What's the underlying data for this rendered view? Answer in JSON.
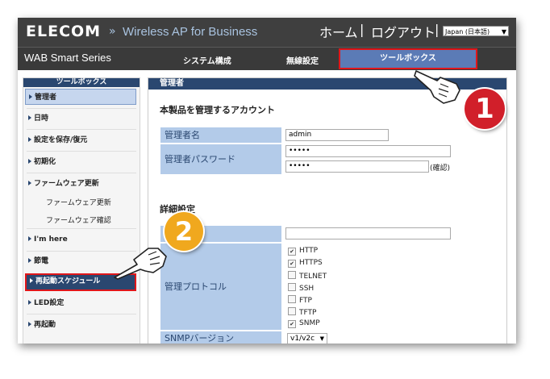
{
  "header": {
    "logo": "ELECOM",
    "separator": "»",
    "product": "Wireless AP for Business",
    "home": "ホーム",
    "divider": "|",
    "logout": "ログアウト",
    "language": "Japan (日本語)"
  },
  "nav": {
    "series": "WAB Smart Series",
    "items": [
      "システム構成",
      "無線設定",
      "ツールボックス"
    ]
  },
  "sidebar": {
    "title": "ツールボックス",
    "items": [
      "管理者",
      "日時",
      "設定を保存/復元",
      "初期化",
      "ファームウェア更新",
      "I'm here",
      "節電",
      "再起動スケジュール",
      "LED設定",
      "再起動"
    ],
    "subitems": [
      "ファームウェア更新",
      "ファームウェア確認"
    ]
  },
  "content": {
    "header": "管理者",
    "account_title": "本製品を管理するアカウント",
    "admin_name_label": "管理者名",
    "admin_name_value": "admin",
    "admin_password_label": "管理者パスワード",
    "password_mask": "•••••",
    "confirm_label": "(確認)",
    "details_title": "詳細設定",
    "protocol_label": "管理プロトコル",
    "protocols": [
      "HTTP",
      "HTTPS",
      "TELNET",
      "SSH",
      "FTP",
      "TFTP",
      "SNMP"
    ],
    "snmp_label": "SNMPバージョン",
    "snmp_value": "v1/v2c"
  },
  "callouts": [
    "1",
    "2"
  ],
  "colors": {
    "accent": "#2a4770",
    "highlight_red": "#e0161a",
    "badge_red": "#d11f2a",
    "badge_yellow": "#f0a81e"
  }
}
